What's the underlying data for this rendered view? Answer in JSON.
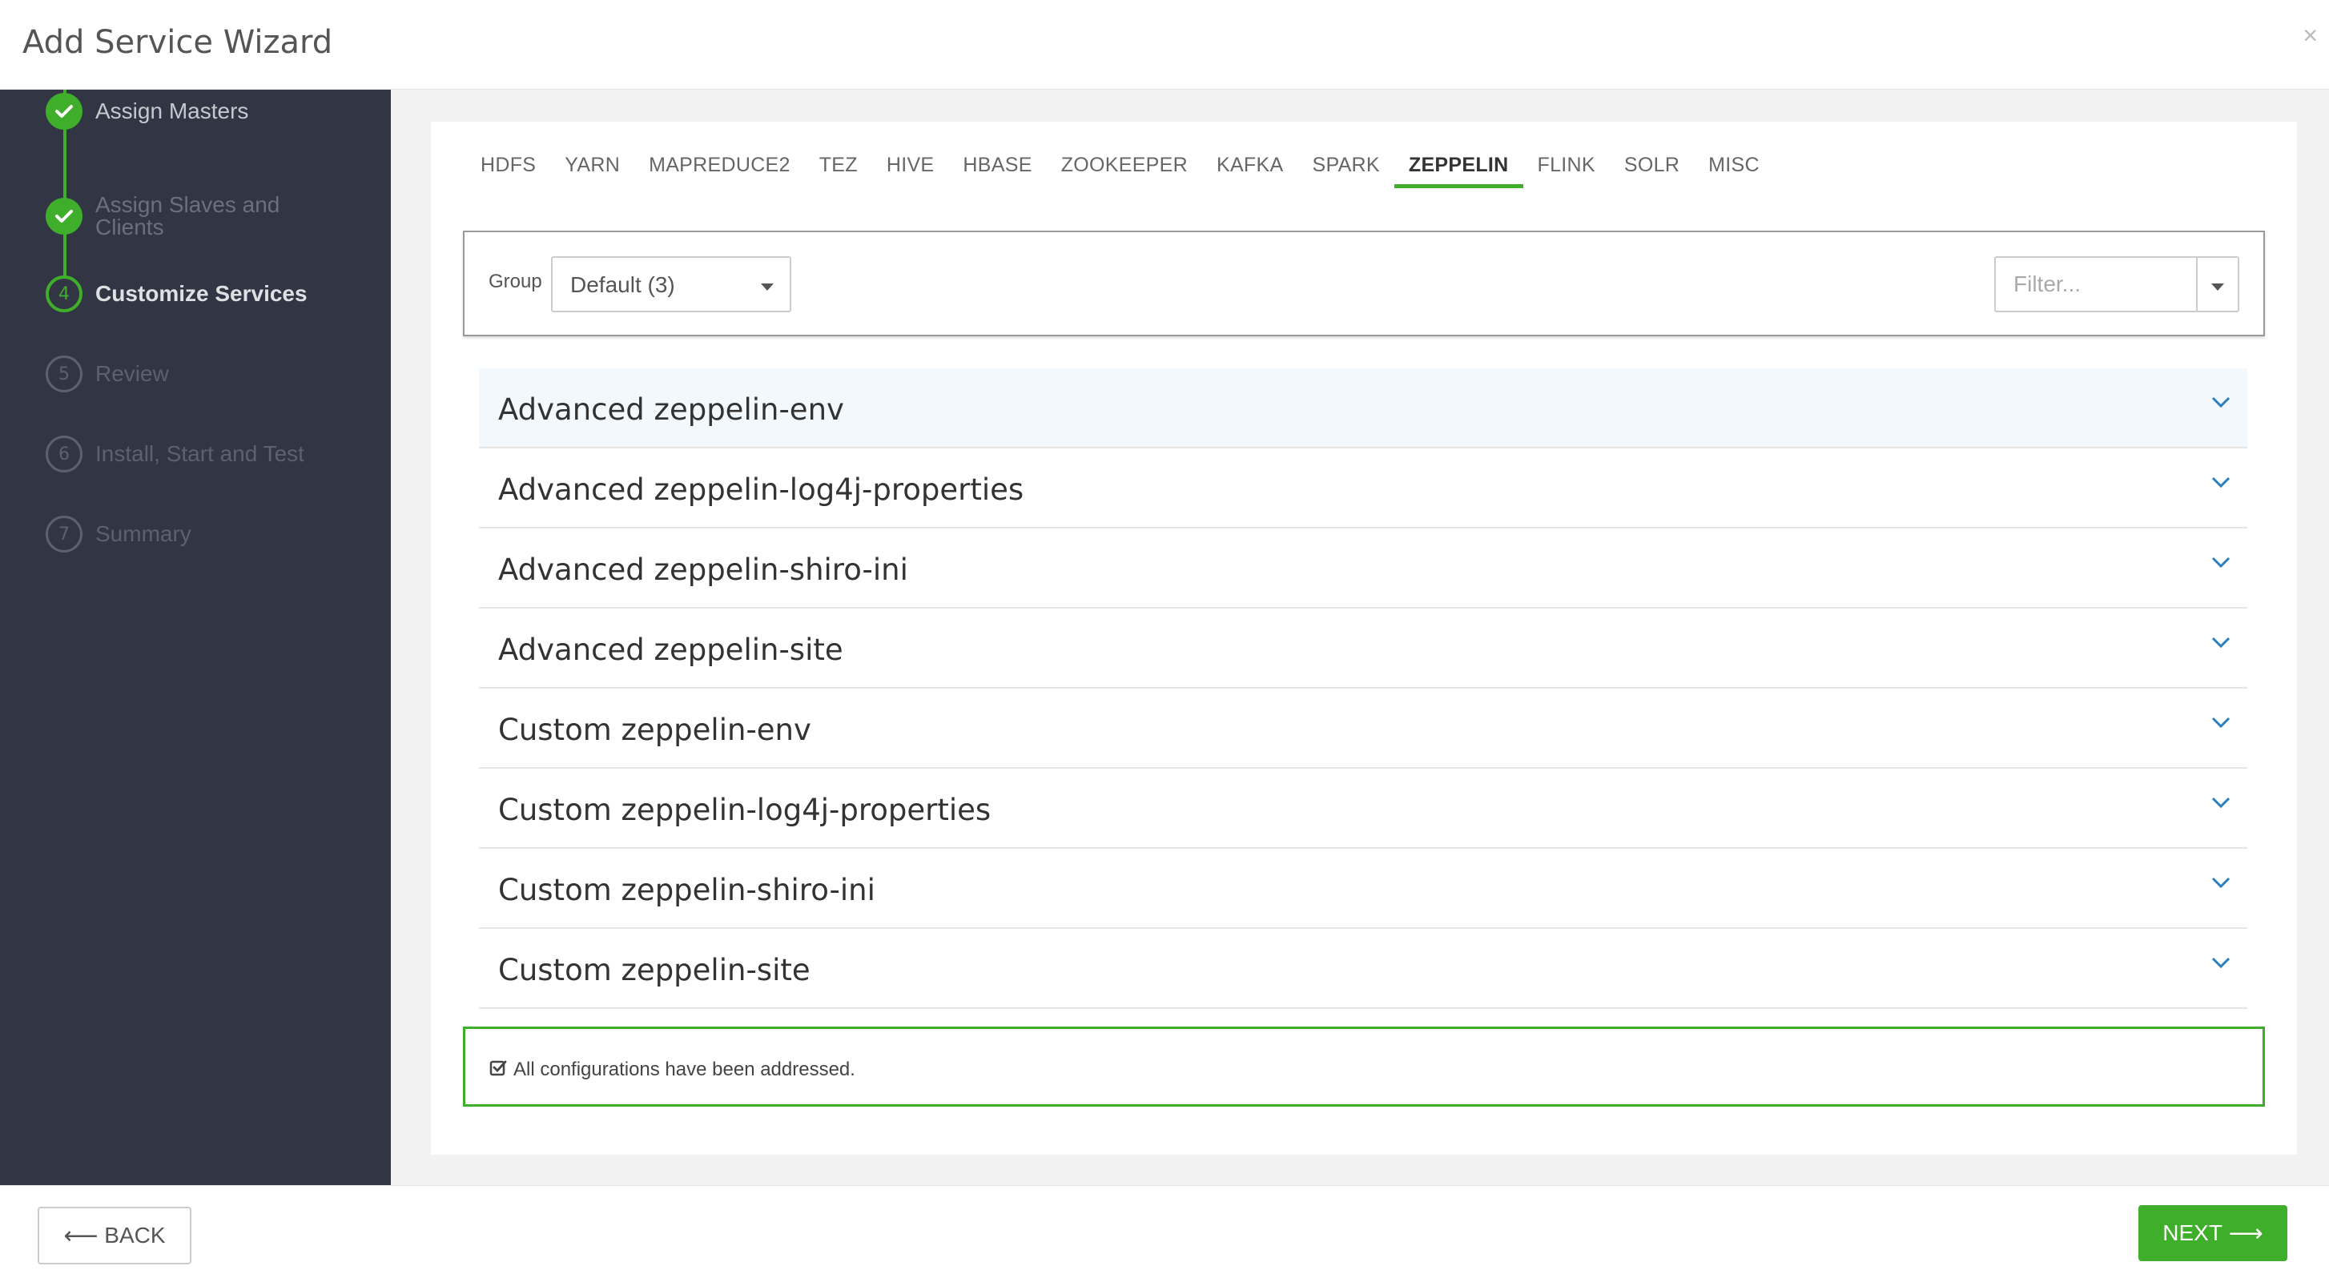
{
  "window": {
    "title": "Add Service Wizard",
    "close_glyph": "×"
  },
  "sidebar": {
    "steps": [
      {
        "number": "",
        "label": "Assign Masters",
        "state": "done"
      },
      {
        "number": "",
        "label": "Assign Slaves and Clients",
        "state": "done"
      },
      {
        "number": "4",
        "label": "Customize Services",
        "state": "current"
      },
      {
        "number": "5",
        "label": "Review",
        "state": "pending"
      },
      {
        "number": "6",
        "label": "Install, Start and Test",
        "state": "pending"
      },
      {
        "number": "7",
        "label": "Summary",
        "state": "pending"
      }
    ]
  },
  "tabs": [
    {
      "label": "HDFS",
      "active": false
    },
    {
      "label": "YARN",
      "active": false
    },
    {
      "label": "MAPREDUCE2",
      "active": false
    },
    {
      "label": "TEZ",
      "active": false
    },
    {
      "label": "HIVE",
      "active": false
    },
    {
      "label": "HBASE",
      "active": false
    },
    {
      "label": "ZOOKEEPER",
      "active": false
    },
    {
      "label": "KAFKA",
      "active": false
    },
    {
      "label": "SPARK",
      "active": false
    },
    {
      "label": "ZEPPELIN",
      "active": true
    },
    {
      "label": "FLINK",
      "active": false
    },
    {
      "label": "SOLR",
      "active": false
    },
    {
      "label": "MISC",
      "active": false
    }
  ],
  "filter_bar": {
    "group_label": "Group",
    "group_value": "Default (3)",
    "filter_placeholder": "Filter..."
  },
  "sections": [
    "Advanced zeppelin-env",
    "Advanced zeppelin-log4j-properties",
    "Advanced zeppelin-shiro-ini",
    "Advanced zeppelin-site",
    "Custom zeppelin-env",
    "Custom zeppelin-log4j-properties",
    "Custom zeppelin-shiro-ini",
    "Custom zeppelin-site"
  ],
  "alert": {
    "message": "All configurations have been addressed."
  },
  "footer": {
    "back_label": "BACK",
    "next_label": "NEXT"
  },
  "colors": {
    "accent": "#3fae2a",
    "sidebar_bg": "#323544",
    "chevron": "#2a7fc1"
  },
  "icons": {
    "step_done": "check-icon",
    "section_toggle": "chevron-down-icon",
    "alert": "check-square-icon",
    "back": "arrow-left-icon",
    "next": "arrow-right-icon"
  }
}
